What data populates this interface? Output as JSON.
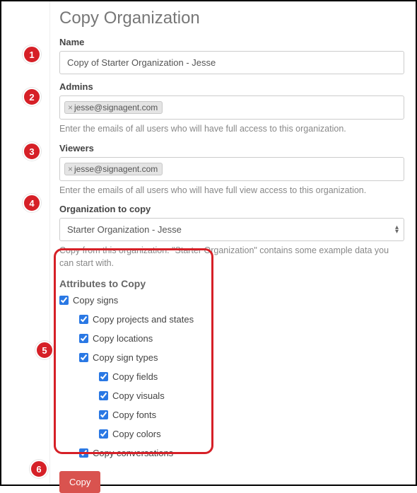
{
  "page_title": "Copy Organization",
  "fields": {
    "name": {
      "label": "Name",
      "value": "Copy of Starter Organization - Jesse"
    },
    "admins": {
      "label": "Admins",
      "tag": "jesse@signagent.com",
      "help": "Enter the emails of all users who will have full access to this organization."
    },
    "viewers": {
      "label": "Viewers",
      "tag": "jesse@signagent.com",
      "help": "Enter the emails of all users who will have full view access to this organization."
    },
    "org_to_copy": {
      "label": "Organization to copy",
      "selected": "Starter Organization - Jesse",
      "help": "Copy from this organization. \"Starter Organization\" contains some example data you can start with."
    }
  },
  "attributes_section": {
    "title": "Attributes to Copy",
    "copy_signs": "Copy signs",
    "copy_projects": "Copy projects and states",
    "copy_locations": "Copy locations",
    "copy_sign_types": "Copy sign types",
    "copy_fields": "Copy fields",
    "copy_visuals": "Copy visuals",
    "copy_fonts": "Copy fonts",
    "copy_colors": "Copy colors",
    "copy_conversations": "Copy conversations"
  },
  "copy_button": "Copy",
  "markers": {
    "m1": "1",
    "m2": "2",
    "m3": "3",
    "m4": "4",
    "m5": "5",
    "m6": "6"
  }
}
